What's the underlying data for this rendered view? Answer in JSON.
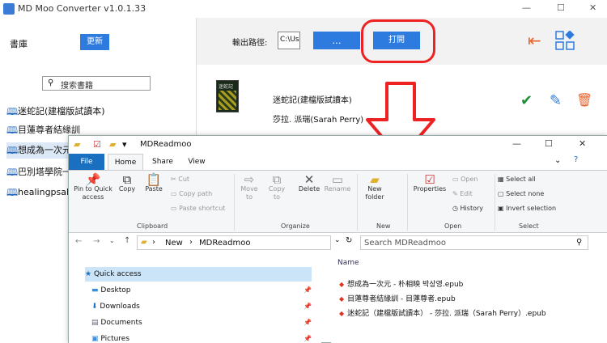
{
  "app": {
    "title": "MD Moo Converter v1.0.1.33",
    "library_label": "書庫",
    "refresh_label": "更新",
    "search_placeholder": "搜索書籍",
    "output_label": "輸出路徑:",
    "path_value": "C:\\Us",
    "browse_label": "...",
    "open_label": "打開",
    "books": [
      "迷蛇記(建檔版試讀本)",
      "目蓮尊者結緣訓",
      "想成為一次元",
      "巴別塔學院一部",
      "healingpsalms"
    ],
    "selected_book": {
      "title": "迷蛇記(建檔版試讀本)",
      "author": "莎拉. 派瑞(Sarah Perry)",
      "cover_text": "迷蛇記"
    },
    "accent": "#2e7be0",
    "highlight": "#e22222"
  },
  "explorer": {
    "title": "MDReadmoo",
    "tabs": {
      "file": "File",
      "home": "Home",
      "share": "Share",
      "view": "View"
    },
    "ribbon": {
      "pin": "Pin to Quick access",
      "copy": "Copy",
      "paste": "Paste",
      "cut": "Cut",
      "copy_path": "Copy path",
      "paste_shortcut": "Paste shortcut",
      "move_to": "Move to",
      "copy_to": "Copy to",
      "delete": "Delete",
      "rename": "Rename",
      "new_folder": "New folder",
      "properties": "Properties",
      "open": "Open",
      "edit": "Edit",
      "history": "History",
      "select_all": "Select all",
      "select_none": "Select none",
      "invert": "Invert selection",
      "groups": {
        "clipboard": "Clipboard",
        "organize": "Organize",
        "new": "New",
        "open": "Open",
        "select": "Select"
      }
    },
    "breadcrumb": [
      "New",
      "MDReadmoo"
    ],
    "search_placeholder": "Search MDReadmoo",
    "nav": [
      "Quick access",
      "Desktop",
      "Downloads",
      "Documents",
      "Pictures"
    ],
    "column_name": "Name",
    "files": [
      "想成為一次元 - 朴相映 박상영.epub",
      "目蓮尊者結緣訓 - 目蓮尊者.epub",
      "迷蛇記（建檔版試讀本） - 莎拉. 派瑞（Sarah Perry）.epub"
    ]
  }
}
